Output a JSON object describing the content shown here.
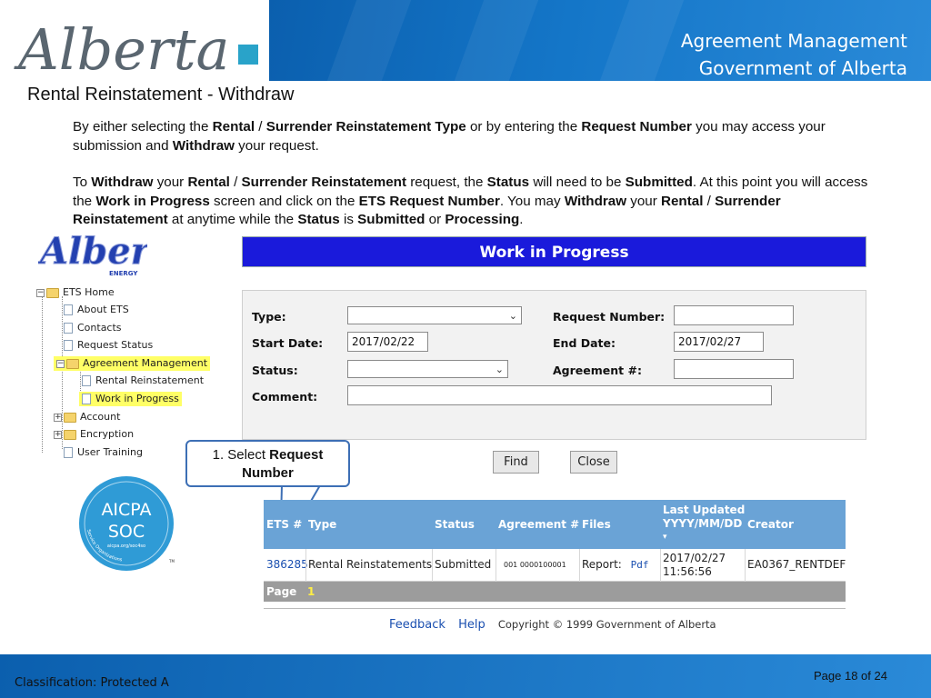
{
  "header": {
    "logo_text": "Alberta",
    "title_line1": "Agreement Management",
    "title_line2": "Government of Alberta"
  },
  "slide_title": "Rental Reinstatement - Withdraw",
  "para1": {
    "t1": "By either selecting the ",
    "b1": "Rental",
    "t2": " / ",
    "b2": "Surrender Reinstatement Type",
    "t3": " or by entering the ",
    "b3": "Request Number",
    "t4": " you may access your submission and ",
    "b4": "Withdraw",
    "t5": " your request."
  },
  "para2": {
    "t1": "To ",
    "b1": "Withdraw",
    "t2": " your ",
    "b2": "Rental",
    "t3": " / ",
    "b3": "Surrender Reinstatement",
    "t4": " request, the ",
    "b4": "Status",
    "t5": " will need to be ",
    "b5": "Submitted",
    "t6": ". At this point you will access the ",
    "b6": "Work in Progress",
    "t7": " screen and click on the ",
    "b7": "ETS Request Number",
    "t8": ".   You may ",
    "b8": "Withdraw",
    "t9": " your ",
    "b9": "Rental",
    "t10": " / ",
    "b10": "Surrender Reinstatement",
    "t11": " at anytime while the ",
    "b11": "Status",
    "t12": " is ",
    "b12": "Submitted",
    "t13": " or ",
    "b13": "Processing",
    "t14": "."
  },
  "energy_logo": {
    "name": "Alberta",
    "sub": "ENERGY"
  },
  "tree": {
    "root": "ETS Home",
    "about": "About ETS",
    "contacts": "Contacts",
    "request_status": "Request Status",
    "agreement_mgmt": "Agreement Management",
    "rental_reinstatement": "Rental Reinstatement",
    "work_in_progress": "Work in Progress",
    "account": "Account",
    "encryption": "Encryption",
    "user_training": "User Training"
  },
  "aicpa": {
    "line1": "AICPA",
    "line2": "SOC",
    "sub": "aicpa.org/soc4so",
    "arc": "Service Organizations",
    "tm": "TM"
  },
  "wip": {
    "title": "Work in Progress",
    "type_label": "Type:",
    "type_value": "",
    "request_number_label": "Request Number:",
    "request_number_value": "",
    "start_date_label": "Start Date:",
    "start_date_value": "2017/02/22",
    "end_date_label": "End Date:",
    "end_date_value": "2017/02/27",
    "status_label": "Status:",
    "status_value": "",
    "agreement_label": "Agreement #:",
    "agreement_value": "",
    "comment_label": "Comment:",
    "comment_value": "",
    "find": "Find",
    "close": "Close"
  },
  "callout": {
    "t1": "1. Select ",
    "b1": "Request",
    "b2": "Number"
  },
  "table": {
    "headers": {
      "ets": "ETS #",
      "type": "Type",
      "status": "Status",
      "agreement": "Agreement #",
      "files": "Files",
      "updated1": "Last Updated",
      "updated2": "YYYY/MM/DD",
      "creator": "Creator"
    },
    "row": {
      "ets": "386285",
      "type": "Rental Reinstatements",
      "status": "Submitted",
      "agreement": "001 0000100001",
      "files_label": "Report:",
      "files_link": "Pdf",
      "date": "2017/02/27",
      "time": "11:56:56",
      "creator": "EA0367_RENTDEF"
    },
    "page_label": "Page",
    "page_number": "1"
  },
  "links": {
    "feedback": "Feedback",
    "help": "Help",
    "copyright": "Copyright © 1999 Government of Alberta"
  },
  "footer": {
    "classification": "Classification: Protected A",
    "page": "Page 18 of 24"
  },
  "colors": {
    "brand_blue": "#0b5fae",
    "wip_header": "#1a1adb",
    "table_header": "#6aa3d6",
    "highlight": "#ffff66"
  }
}
